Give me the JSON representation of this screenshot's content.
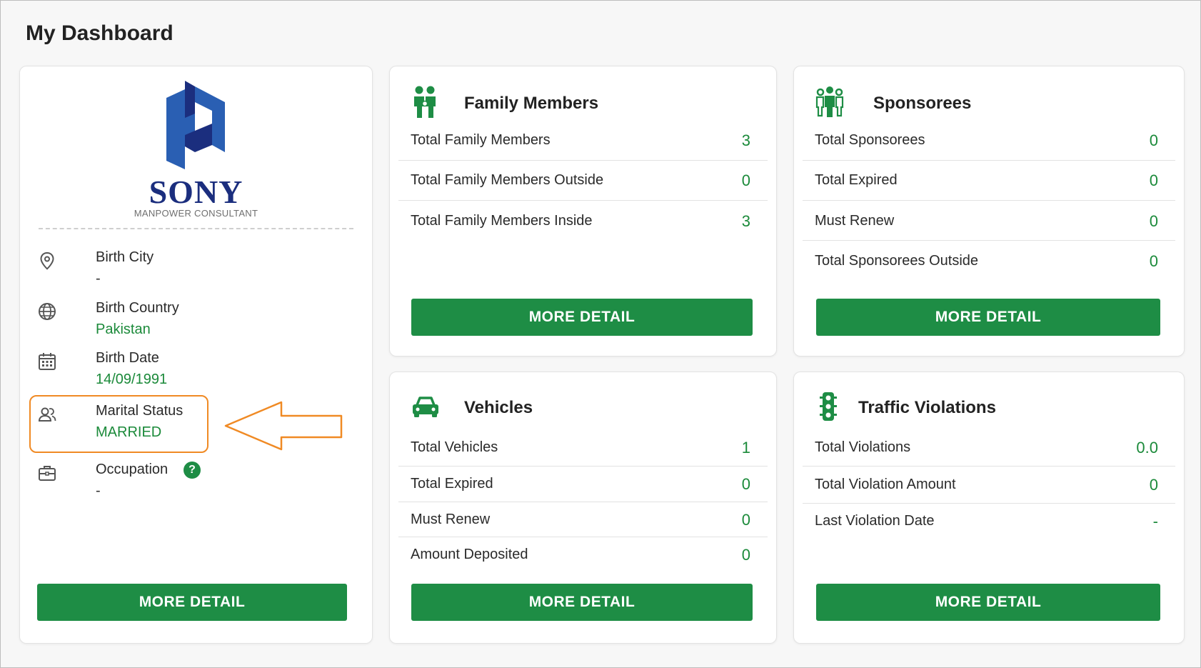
{
  "page_title": "My Dashboard",
  "brand": {
    "logo_word": "SONY",
    "logo_tagline": "MANPOWER CONSULTANT",
    "logo_colors": [
      "#2a5fb3",
      "#1b2e7e"
    ]
  },
  "colors": {
    "accent_green": "#1e8d45",
    "value_green": "#1b8a3a",
    "highlight_orange": "#f08a24"
  },
  "profile": {
    "items": [
      {
        "icon": "location-pin-icon",
        "label": "Birth City",
        "value": "-"
      },
      {
        "icon": "globe-icon",
        "label": "Birth Country",
        "value": "Pakistan"
      },
      {
        "icon": "calendar-icon",
        "label": "Birth Date",
        "value": "14/09/1991"
      },
      {
        "icon": "users-icon",
        "label": "Marital Status",
        "value": "MARRIED"
      },
      {
        "icon": "briefcase-icon",
        "label": "Occupation",
        "value": "-",
        "help": "?"
      }
    ],
    "button_label": "MORE DETAIL"
  },
  "family_members": {
    "title": "Family Members",
    "icon": "family-icon",
    "rows": [
      {
        "label": "Total Family Members",
        "value": "3"
      },
      {
        "label": "Total Family Members Outside",
        "value": "0"
      },
      {
        "label": "Total Family Members Inside",
        "value": "3"
      }
    ],
    "button_label": "MORE DETAIL"
  },
  "sponsorees": {
    "title": "Sponsorees",
    "icon": "group-icon",
    "rows": [
      {
        "label": "Total Sponsorees",
        "value": "0"
      },
      {
        "label": "Total Expired",
        "value": "0"
      },
      {
        "label": "Must Renew",
        "value": "0"
      },
      {
        "label": "Total Sponsorees Outside",
        "value": "0"
      }
    ],
    "button_label": "MORE DETAIL"
  },
  "vehicles": {
    "title": "Vehicles",
    "icon": "car-icon",
    "rows": [
      {
        "label": "Total Vehicles",
        "value": "1"
      },
      {
        "label": "Total Expired",
        "value": "0"
      },
      {
        "label": "Must Renew",
        "value": "0"
      },
      {
        "label": "Amount Deposited",
        "value": "0"
      }
    ],
    "button_label": "MORE DETAIL"
  },
  "traffic_violations": {
    "title": "Traffic Violations",
    "icon": "traffic-light-icon",
    "rows": [
      {
        "label": "Total Violations",
        "value": "0.0"
      },
      {
        "label": "Total Violation Amount",
        "value": "0"
      },
      {
        "label": "Last Violation Date",
        "value": "-"
      }
    ],
    "button_label": "MORE DETAIL"
  }
}
